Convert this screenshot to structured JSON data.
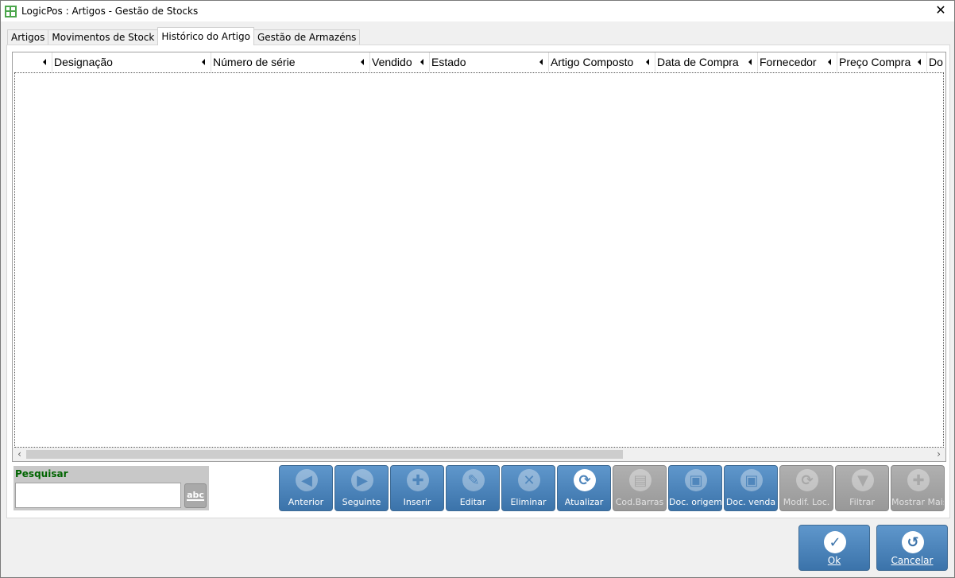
{
  "window": {
    "title": "LogicPos : Artigos - Gestão de Stocks",
    "close_glyph": "✕"
  },
  "tabs": [
    {
      "label": "Artigos"
    },
    {
      "label": "Movimentos de Stock"
    },
    {
      "label": "Histórico do Artigo"
    },
    {
      "label": "Gestão de Armazéns"
    }
  ],
  "grid": {
    "columns": [
      {
        "label": ""
      },
      {
        "label": "Designação"
      },
      {
        "label": "Número de série"
      },
      {
        "label": "Vendido"
      },
      {
        "label": "Estado"
      },
      {
        "label": "Artigo Composto"
      },
      {
        "label": "Data de Compra"
      },
      {
        "label": "Fornecedor"
      },
      {
        "label": "Preço Compra"
      },
      {
        "label": "Do"
      }
    ],
    "rows": [],
    "scroll_left": "‹",
    "scroll_right": "›"
  },
  "search": {
    "label": "Pesquisar",
    "value": "",
    "abc_label": "abc"
  },
  "toolbar": {
    "buttons": [
      {
        "label": "Anterior",
        "icon": "◀",
        "enabled": true
      },
      {
        "label": "Seguinte",
        "icon": "▶",
        "enabled": true
      },
      {
        "label": "Inserir",
        "icon": "✚",
        "enabled": true
      },
      {
        "label": "Editar",
        "icon": "✎",
        "enabled": true
      },
      {
        "label": "Eliminar",
        "icon": "✕",
        "enabled": true
      },
      {
        "label": "Atualizar",
        "icon": "⟳",
        "enabled": true
      },
      {
        "label": "Cod.Barras",
        "icon": "▤",
        "enabled": false
      },
      {
        "label": "Doc. origem",
        "icon": "▣",
        "enabled": true
      },
      {
        "label": "Doc. venda",
        "icon": "▣",
        "enabled": true
      },
      {
        "label": "Modif. Loc.",
        "icon": "⟳",
        "enabled": false
      },
      {
        "label": "Filtrar",
        "icon": "▼",
        "enabled": false
      },
      {
        "label": "Mostrar Mais",
        "icon": "✚",
        "enabled": false
      }
    ]
  },
  "dialog_buttons": {
    "ok_label": "Ok",
    "ok_icon": "✓",
    "cancel_label": "Cancelar",
    "cancel_icon": "↺"
  }
}
